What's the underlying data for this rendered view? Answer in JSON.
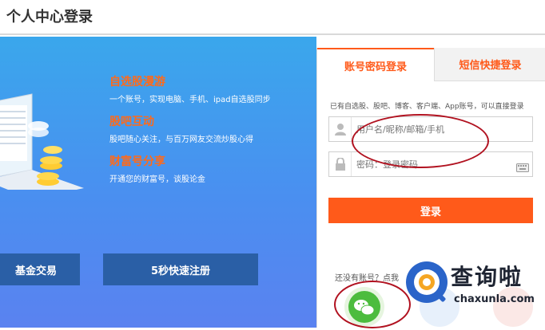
{
  "header": {
    "title": "个人中心登录"
  },
  "banner": {
    "features": [
      {
        "title": "自选股漫游",
        "desc": "一个账号，实现电脑、手机、ipad自选股同步"
      },
      {
        "title": "股吧互动",
        "desc": "股吧随心关注，与百万网友交流炒股心得"
      },
      {
        "title": "财富号分享",
        "desc": "开通您的财富号，谈股论金"
      }
    ],
    "buttons": {
      "fund": "基金交易",
      "register": "5秒快速注册"
    }
  },
  "login": {
    "tabs": {
      "password": "账号密码登录",
      "sms": "短信快捷登录"
    },
    "hint": "已有自选股、股吧、博客、客户端、App账号，可以直接登录",
    "username_placeholder": "用户名/昵称/邮箱/手机",
    "password_placeholder": "密码：登录密码",
    "submit": "登录",
    "register_hint": "还没有账号？点我"
  },
  "watermark": {
    "brand": "查询啦",
    "domain": "chaxunla.com"
  },
  "colors": {
    "accent": "#ff5a1a",
    "banner_blue": "#3aa7ec",
    "button_dark": "#2a5fa6",
    "annotation_red": "#b11220"
  }
}
